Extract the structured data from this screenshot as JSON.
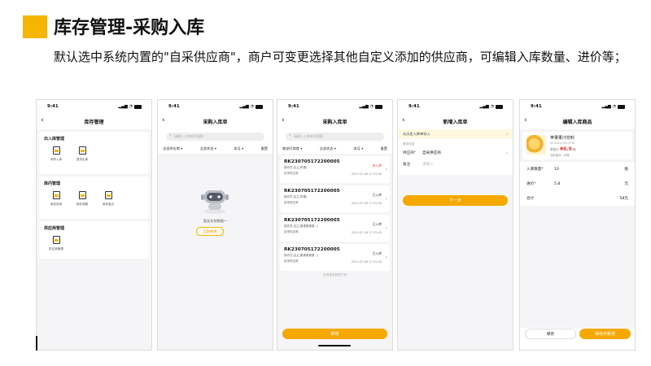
{
  "header": {
    "title": "库存管理-采购入库",
    "description": "默认选中系统内置的\"自采供应商\"，商户可变更选择其他自定义添加的供应商，可编辑入库数量、进价等；"
  },
  "status_time": "9:41",
  "screens": {
    "s1": {
      "nav_title": "库存管理",
      "sections": [
        {
          "title": "出入库管理",
          "items": [
            "采购入库",
            "退货出库"
          ]
        },
        {
          "title": "库内管理",
          "items": [
            "库存查询",
            "库存调整",
            "库存盘点"
          ]
        },
        {
          "title": "供应商管理",
          "items": [
            "供应商管理"
          ]
        }
      ]
    },
    "s2": {
      "nav_title": "采购入库单",
      "search_placeholder": "请输入入库单号搜索",
      "filters": [
        "全部供应商",
        "全部状态",
        "本月",
        "重置"
      ],
      "empty_text": "暂无任何数据～",
      "empty_button": "立即新增"
    },
    "s3": {
      "nav_title": "采购入库单",
      "search_placeholder": "请输入入库单号搜索",
      "filters": [
        "临安旺商食",
        "全部状态",
        "本月",
        "重置"
      ],
      "records": [
        {
          "no": "RK230705172200005",
          "operator": "操作员:店主(苹果)",
          "supplier": "自采供应商",
          "status": "未入库",
          "date": "2023-07-06 17:22:40"
        },
        {
          "no": "RK230705172200005",
          "operator": "操作员:店主(苹果)",
          "supplier": "自采供应商",
          "status": "已入库",
          "date": "2023-07-06 17:22:40"
        },
        {
          "no": "RK230705172200005",
          "operator": "操作员:店主(果果果果果...)",
          "supplier": "自采供应商",
          "status": "已入库",
          "date": "2023-07-06 17:22:40"
        },
        {
          "no": "RK230705172200005",
          "operator": "操作员:店主(果果果果果...)",
          "supplier": "自采供应商",
          "status": "已入库",
          "date": "2023-07-06 17:22:40"
        }
      ],
      "no_more": "没有更多数据了哦",
      "add_button": "新增"
    },
    "s4": {
      "nav_title": "新增入库单",
      "hint": "从历史入库单导入",
      "mini_label": "基本信息",
      "supplier_label": "供应商*",
      "supplier_value": "自采供应商",
      "remark_label": "备注",
      "remark_placeholder": "请输入",
      "next_button": "下一步"
    },
    "s5": {
      "nav_title": "编辑入库商品",
      "product": {
        "name": "苹果果汁饮料",
        "code": "69388001820798",
        "price_label": "零售价",
        "price": "¥6.9",
        "price_unit": "/瓶",
        "stock_label": "当前库存: 20瓶"
      },
      "rows": [
        {
          "label": "入库数量*",
          "value": "10",
          "unit": "瓶"
        },
        {
          "label": "进价*",
          "value": "5.8",
          "unit": "元"
        },
        {
          "label": "合计",
          "value": "",
          "unit": "58元"
        }
      ],
      "save_button": "保存",
      "save_add_button": "保存并新增"
    }
  },
  "colors": {
    "accent": "#f5a800",
    "title_block": "#f5b500",
    "danger": "#e03c31"
  }
}
